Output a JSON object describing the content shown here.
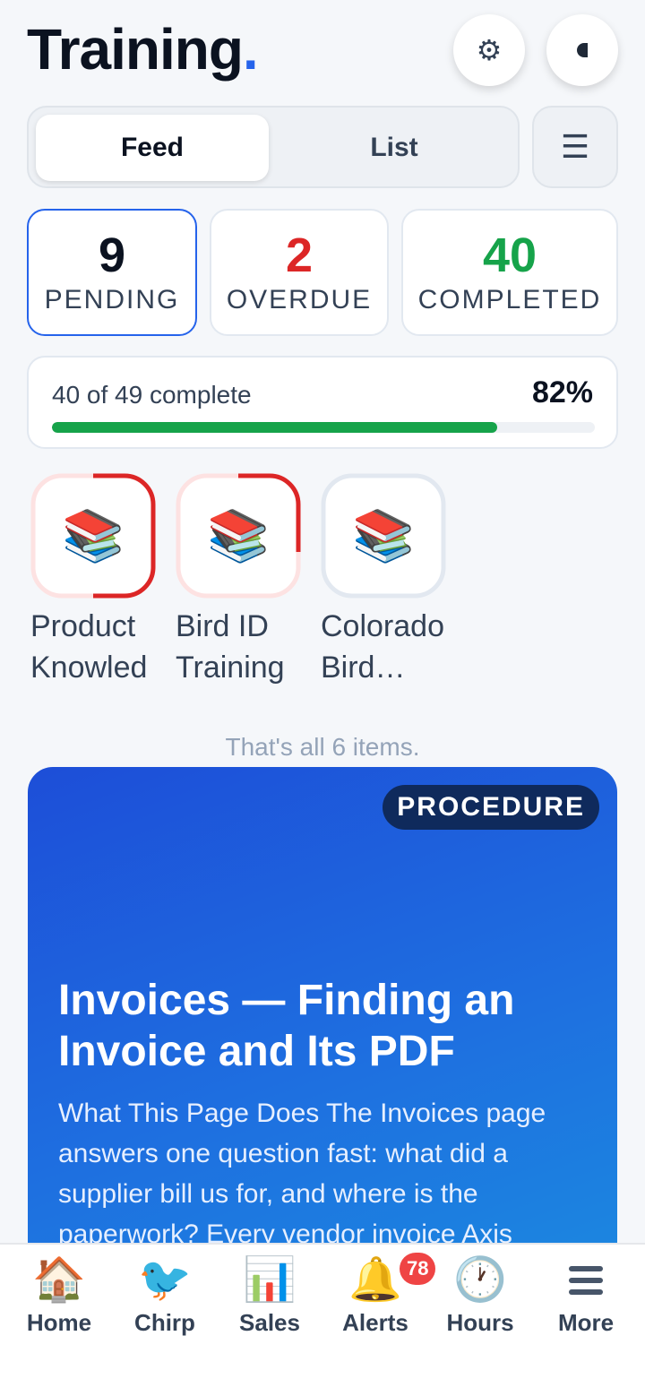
{
  "header": {
    "title": "Training",
    "title_dot": ".",
    "settings_icon": "⚙",
    "theme_icon": "half-moon-icon"
  },
  "view_toggle": {
    "tabs": [
      {
        "label": "Feed",
        "active": true
      },
      {
        "label": "List",
        "active": false
      }
    ],
    "menu_icon": "☰"
  },
  "stats": {
    "pending": {
      "value": "9",
      "label": "PENDING",
      "color": "#0b1220"
    },
    "overdue": {
      "value": "2",
      "label": "OVERDUE",
      "color": "#dc2626"
    },
    "completed": {
      "value": "40",
      "label": "COMPLETED",
      "color": "#16a34a"
    }
  },
  "progress": {
    "text": "40 of 49 complete",
    "percent_label": "82%",
    "fraction": 0.82,
    "color": "#16a34a"
  },
  "stories": [
    {
      "icon": "📚",
      "label_line1": "Product",
      "label_line2": "Knowled",
      "ring": "red-partial"
    },
    {
      "icon": "📚",
      "label_line1": "Bird ID",
      "label_line2": "Training",
      "ring": "red-quarter"
    },
    {
      "icon": "📚",
      "label_line1": "Colorado",
      "label_line2": "Bird…",
      "ring": "gray"
    }
  ],
  "feed": {
    "end_note": "That's all 6 items.",
    "card": {
      "badge": "PROCEDURE",
      "title": "Invoices — Finding an Invoice and Its PDF",
      "body": "What This Page Does The Invoices page answers one question fast: what did a supplier bill us for, and where is the paperwork? Every vendor invoice Axis"
    }
  },
  "tabbar": {
    "tabs": [
      {
        "label": "Home",
        "icon": "🏠"
      },
      {
        "label": "Chirp",
        "icon": "🐦"
      },
      {
        "label": "Sales",
        "icon": "📊"
      },
      {
        "label": "Alerts",
        "icon": "🔔",
        "badge": "78"
      },
      {
        "label": "Hours",
        "icon": "🕐"
      },
      {
        "label": "More",
        "icon": "menu-icon"
      }
    ]
  }
}
